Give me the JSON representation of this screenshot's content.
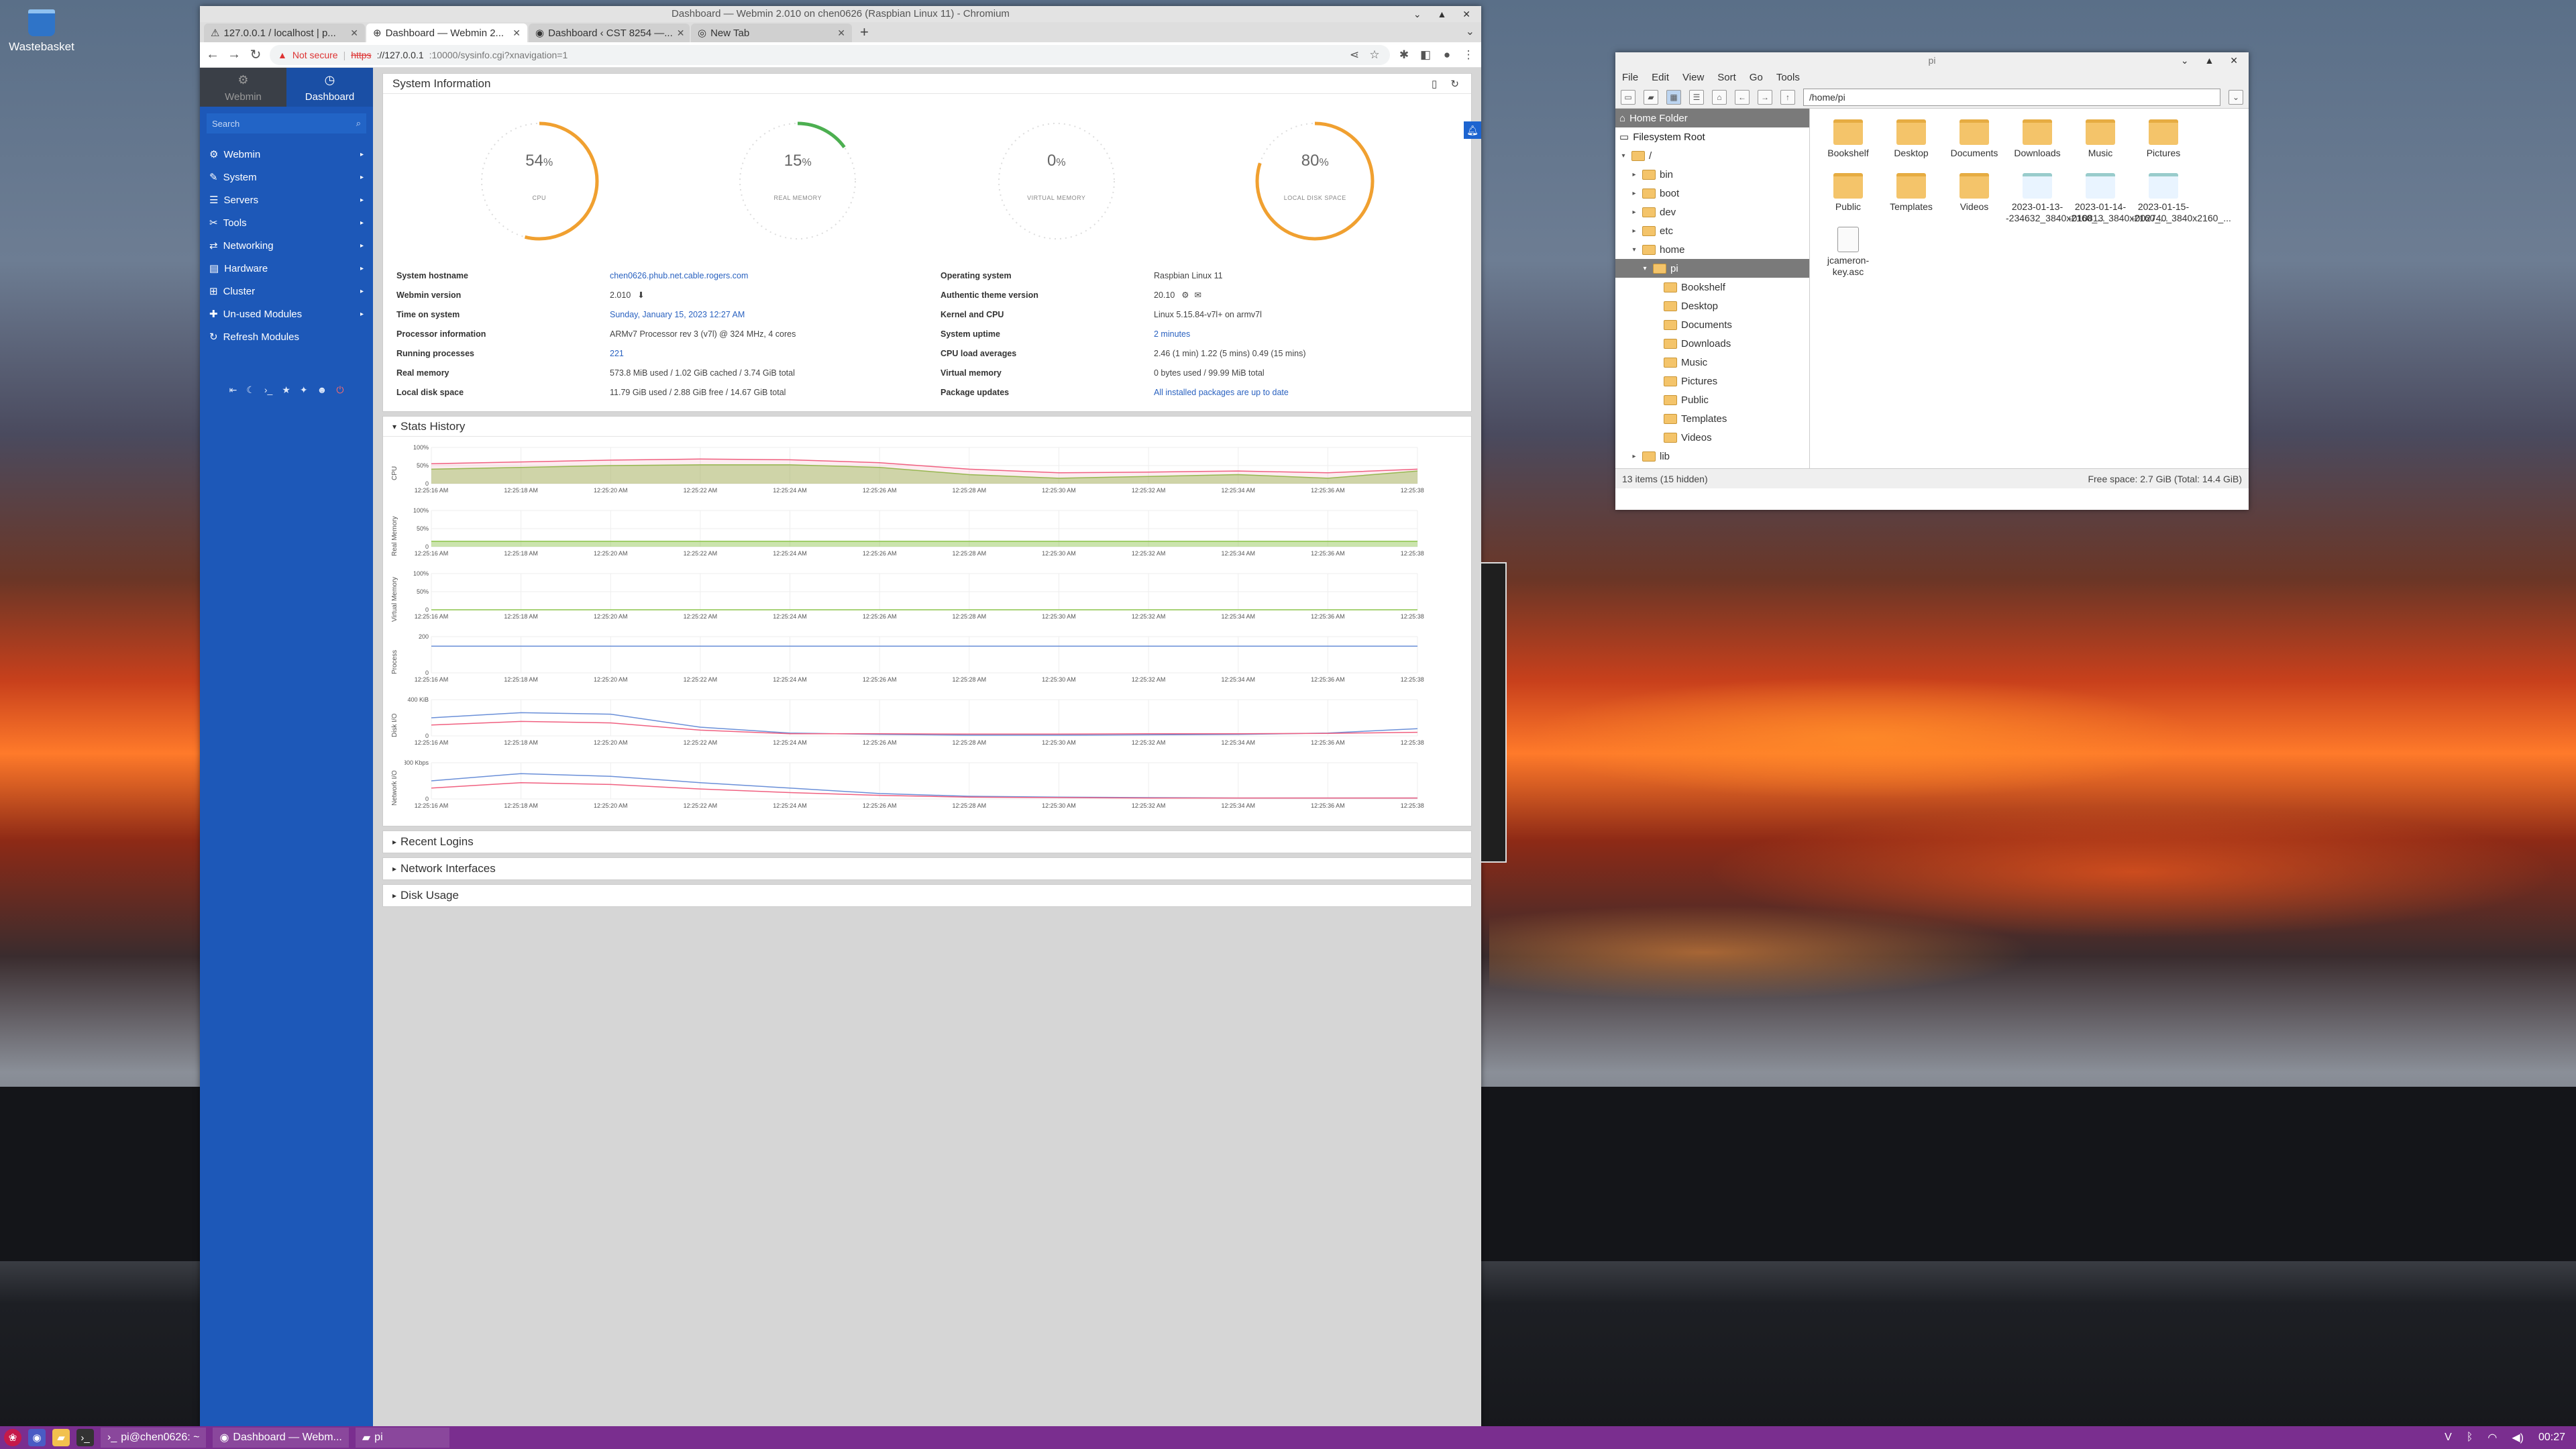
{
  "desktop": {
    "wastebasket_label": "Wastebasket"
  },
  "browser": {
    "title": "Dashboard — Webmin 2.010 on chen0626 (Raspbian Linux 11) - Chromium",
    "tabs": [
      {
        "label": "127.0.0.1 / localhost | p..."
      },
      {
        "label": "Dashboard — Webmin 2..."
      },
      {
        "label": "Dashboard ‹ CST 8254 —..."
      },
      {
        "label": "New Tab"
      }
    ],
    "url": {
      "security": "Not secure",
      "scheme": "https",
      "host": "://127.0.0.1",
      "path": ":10000/sysinfo.cgi?xnavigation=1"
    }
  },
  "sidebar": {
    "tab_webmin": "Webmin",
    "tab_dashboard": "Dashboard",
    "search_placeholder": "Search",
    "items": [
      {
        "label": "Webmin",
        "icon": "gear-icon"
      },
      {
        "label": "System",
        "icon": "wrench-icon"
      },
      {
        "label": "Servers",
        "icon": "server-icon"
      },
      {
        "label": "Tools",
        "icon": "tools-icon"
      },
      {
        "label": "Networking",
        "icon": "network-icon"
      },
      {
        "label": "Hardware",
        "icon": "hardware-icon"
      },
      {
        "label": "Cluster",
        "icon": "cluster-icon"
      },
      {
        "label": "Un-used Modules",
        "icon": "puzzle-icon"
      },
      {
        "label": "Refresh Modules",
        "icon": "refresh-icon"
      }
    ]
  },
  "system_info": {
    "heading": "System Information",
    "gauges": [
      {
        "label": "CPU",
        "value": "54",
        "unit": "%",
        "fraction": 0.54,
        "color": "#f0a030"
      },
      {
        "label": "REAL MEMORY",
        "value": "15",
        "unit": "%",
        "fraction": 0.15,
        "color": "#4caf50"
      },
      {
        "label": "VIRTUAL MEMORY",
        "value": "0",
        "unit": "%",
        "fraction": 0.0,
        "color": "#bbbbbb"
      },
      {
        "label": "LOCAL DISK SPACE",
        "value": "80",
        "unit": "%",
        "fraction": 0.8,
        "color": "#f0a030"
      }
    ],
    "left": [
      {
        "k": "System hostname",
        "v": "chen0626.phub.net.cable.rogers.com",
        "link": true
      },
      {
        "k": "Webmin version",
        "v": "2.010"
      },
      {
        "k": "Time on system",
        "v": "Sunday, January 15, 2023 12:27 AM",
        "link": true
      },
      {
        "k": "Processor information",
        "v": "ARMv7 Processor rev 3 (v7l) @ 324 MHz, 4 cores"
      },
      {
        "k": "Running processes",
        "v": "221",
        "link": true
      },
      {
        "k": "Real memory",
        "v": "573.8 MiB used / 1.02 GiB cached / 3.74 GiB total"
      },
      {
        "k": "Local disk space",
        "v": "11.79 GiB used / 2.88 GiB free / 14.67 GiB total"
      }
    ],
    "right": [
      {
        "k": "Operating system",
        "v": "Raspbian Linux 11"
      },
      {
        "k": "Authentic theme version",
        "v": "20.10"
      },
      {
        "k": "Kernel and CPU",
        "v": "Linux 5.15.84-v7l+ on armv7l"
      },
      {
        "k": "System uptime",
        "v": "2 minutes",
        "link": true
      },
      {
        "k": "CPU load averages",
        "v": "2.46 (1 min) 1.22 (5 mins) 0.49 (15 mins)"
      },
      {
        "k": "Virtual memory",
        "v": "0 bytes used / 99.99 MiB total"
      },
      {
        "k": "Package updates",
        "v": "All installed packages are up to date",
        "link": true
      }
    ]
  },
  "stats": {
    "heading": "Stats History",
    "x_labels": [
      "12:25:16 AM",
      "12:25:18 AM",
      "12:25:20 AM",
      "12:25:22 AM",
      "12:25:24 AM",
      "12:25:26 AM",
      "12:25:28 AM",
      "12:25:30 AM",
      "12:25:32 AM",
      "12:25:34 AM",
      "12:25:36 AM",
      "12:25:38 AM"
    ]
  },
  "chart_data": [
    {
      "type": "area",
      "title": "CPU",
      "yticks": [
        "100%",
        "50%",
        "0"
      ],
      "ylim": [
        0,
        100
      ],
      "x": [
        "12:25:16 AM",
        "12:25:18 AM",
        "12:25:20 AM",
        "12:25:22 AM",
        "12:25:24 AM",
        "12:25:26 AM",
        "12:25:28 AM",
        "12:25:30 AM",
        "12:25:32 AM",
        "12:25:34 AM",
        "12:25:36 AM",
        "12:25:38 AM"
      ],
      "series": [
        {
          "values": [
            40,
            45,
            50,
            52,
            52,
            45,
            25,
            15,
            20,
            25,
            15,
            35
          ],
          "color": "#8bc34a"
        },
        {
          "values": [
            55,
            60,
            65,
            68,
            66,
            58,
            40,
            30,
            32,
            35,
            30,
            40
          ],
          "color": "#f06080"
        }
      ]
    },
    {
      "type": "area",
      "title": "Real Memory",
      "yticks": [
        "100%",
        "50%",
        "0"
      ],
      "ylim": [
        0,
        100
      ],
      "x": [
        "12:25:16 AM",
        "12:25:18 AM",
        "12:25:20 AM",
        "12:25:22 AM",
        "12:25:24 AM",
        "12:25:26 AM",
        "12:25:28 AM",
        "12:25:30 AM",
        "12:25:32 AM",
        "12:25:34 AM",
        "12:25:36 AM",
        "12:25:38 AM"
      ],
      "series": [
        {
          "values": [
            15,
            15,
            15,
            15,
            15,
            15,
            15,
            15,
            15,
            15,
            15,
            15
          ],
          "color": "#8bc34a"
        }
      ]
    },
    {
      "type": "area",
      "title": "Virtual Memory",
      "yticks": [
        "100%",
        "50%",
        "0"
      ],
      "ylim": [
        0,
        100
      ],
      "x": [
        "12:25:16 AM",
        "12:25:18 AM",
        "12:25:20 AM",
        "12:25:22 AM",
        "12:25:24 AM",
        "12:25:26 AM",
        "12:25:28 AM",
        "12:25:30 AM",
        "12:25:32 AM",
        "12:25:34 AM",
        "12:25:36 AM",
        "12:25:38 AM"
      ],
      "series": [
        {
          "values": [
            0,
            0,
            0,
            0,
            0,
            0,
            0,
            0,
            0,
            0,
            0,
            0
          ],
          "color": "#8bc34a"
        }
      ]
    },
    {
      "type": "line",
      "title": "Process",
      "yticks": [
        "200",
        "0"
      ],
      "ylim": [
        0,
        300
      ],
      "x": [
        "12:25:16 AM",
        "12:25:18 AM",
        "12:25:20 AM",
        "12:25:22 AM",
        "12:25:24 AM",
        "12:25:26 AM",
        "12:25:28 AM",
        "12:25:30 AM",
        "12:25:32 AM",
        "12:25:34 AM",
        "12:25:36 AM",
        "12:25:38 AM"
      ],
      "series": [
        {
          "values": [
            221,
            221,
            221,
            221,
            221,
            221,
            221,
            221,
            221,
            221,
            221,
            221
          ],
          "color": "#6a8fd8"
        }
      ]
    },
    {
      "type": "line",
      "title": "Disk I/O",
      "yticks": [
        "400 KiB",
        "0"
      ],
      "ylim": [
        0,
        500
      ],
      "x": [
        "12:25:16 AM",
        "12:25:18 AM",
        "12:25:20 AM",
        "12:25:22 AM",
        "12:25:24 AM",
        "12:25:26 AM",
        "12:25:28 AM",
        "12:25:30 AM",
        "12:25:32 AM",
        "12:25:34 AM",
        "12:25:36 AM",
        "12:25:38 AM"
      ],
      "series": [
        {
          "values": [
            250,
            320,
            300,
            120,
            40,
            20,
            10,
            10,
            15,
            20,
            40,
            100
          ],
          "color": "#6a8fd8"
        },
        {
          "values": [
            150,
            200,
            180,
            80,
            30,
            30,
            25,
            25,
            30,
            30,
            35,
            50
          ],
          "color": "#f06080"
        }
      ]
    },
    {
      "type": "line",
      "title": "Network I/O",
      "yticks": [
        "300 Kbps",
        "0"
      ],
      "ylim": [
        0,
        400
      ],
      "x": [
        "12:25:16 AM",
        "12:25:18 AM",
        "12:25:20 AM",
        "12:25:22 AM",
        "12:25:24 AM",
        "12:25:26 AM",
        "12:25:28 AM",
        "12:25:30 AM",
        "12:25:32 AM",
        "12:25:34 AM",
        "12:25:36 AM",
        "12:25:38 AM"
      ],
      "series": [
        {
          "values": [
            200,
            280,
            250,
            180,
            120,
            60,
            30,
            20,
            15,
            10,
            10,
            10
          ],
          "color": "#6a8fd8"
        },
        {
          "values": [
            120,
            180,
            160,
            110,
            70,
            40,
            20,
            15,
            10,
            10,
            10,
            10
          ],
          "color": "#f06080"
        }
      ]
    }
  ],
  "sections": {
    "recent_logins": "Recent Logins",
    "network_interfaces": "Network Interfaces",
    "disk_usage": "Disk Usage"
  },
  "filemanager": {
    "title": "pi",
    "menu": [
      "File",
      "Edit",
      "View",
      "Sort",
      "Go",
      "Tools"
    ],
    "path": "/home/pi",
    "places": [
      "Home Folder",
      "Filesystem Root"
    ],
    "tree": [
      {
        "label": "/",
        "depth": 0,
        "arrow": "▾"
      },
      {
        "label": "bin",
        "depth": 1,
        "arrow": "▸"
      },
      {
        "label": "boot",
        "depth": 1,
        "arrow": "▸"
      },
      {
        "label": "dev",
        "depth": 1,
        "arrow": "▸"
      },
      {
        "label": "etc",
        "depth": 1,
        "arrow": "▸"
      },
      {
        "label": "home",
        "depth": 1,
        "arrow": "▾"
      },
      {
        "label": "pi",
        "depth": 2,
        "arrow": "▾",
        "selected": true
      },
      {
        "label": "Bookshelf",
        "depth": 3,
        "arrow": ""
      },
      {
        "label": "Desktop",
        "depth": 3,
        "arrow": ""
      },
      {
        "label": "Documents",
        "depth": 3,
        "arrow": ""
      },
      {
        "label": "Downloads",
        "depth": 3,
        "arrow": ""
      },
      {
        "label": "Music",
        "depth": 3,
        "arrow": ""
      },
      {
        "label": "Pictures",
        "depth": 3,
        "arrow": ""
      },
      {
        "label": "Public",
        "depth": 3,
        "arrow": ""
      },
      {
        "label": "Templates",
        "depth": 3,
        "arrow": ""
      },
      {
        "label": "Videos",
        "depth": 3,
        "arrow": ""
      },
      {
        "label": "lib",
        "depth": 1,
        "arrow": "▸"
      }
    ],
    "files": [
      {
        "name": "Bookshelf",
        "kind": "folder"
      },
      {
        "name": "Desktop",
        "kind": "folder"
      },
      {
        "name": "Documents",
        "kind": "folder"
      },
      {
        "name": "Downloads",
        "kind": "folder"
      },
      {
        "name": "Music",
        "kind": "folder"
      },
      {
        "name": "Pictures",
        "kind": "folder"
      },
      {
        "name": "Public",
        "kind": "folder"
      },
      {
        "name": "Templates",
        "kind": "folder"
      },
      {
        "name": "Videos",
        "kind": "folder"
      },
      {
        "name": "2023-01-13--234632_3840x2160_...",
        "kind": "img"
      },
      {
        "name": "2023-01-14--010813_3840x2160_...",
        "kind": "img"
      },
      {
        "name": "2023-01-15--002740_3840x2160_...",
        "kind": "img"
      },
      {
        "name": "jcameron-key.asc",
        "kind": "doc"
      }
    ],
    "status_left": "13 items (15 hidden)",
    "status_right": "Free space: 2.7 GiB (Total: 14.4 GiB)"
  },
  "taskbar": {
    "tasks": [
      "pi@chen0626: ~",
      "Dashboard — Webm...",
      "pi"
    ],
    "clock": "00:27"
  }
}
